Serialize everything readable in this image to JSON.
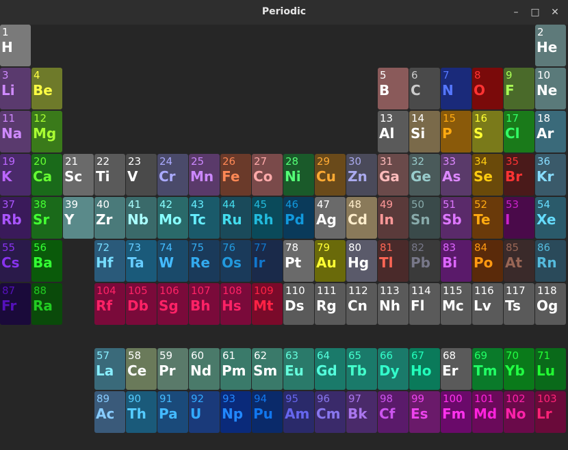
{
  "window": {
    "title": "Periodic",
    "minimize_label": "–",
    "maximize_label": "□",
    "close_label": "✕"
  },
  "elements": [
    {
      "n": "1",
      "s": "H",
      "r": 1,
      "c": 1,
      "bg": "#7a7a7a",
      "fg": "#ffffff"
    },
    {
      "n": "2",
      "s": "He",
      "r": 1,
      "c": 18,
      "bg": "#5e7a7a",
      "fg": "#ffffff"
    },
    {
      "n": "3",
      "s": "Li",
      "r": 2,
      "c": 1,
      "bg": "#5a3a6e",
      "fg": "#cf8aff"
    },
    {
      "n": "4",
      "s": "Be",
      "r": 2,
      "c": 2,
      "bg": "#6e7a2a",
      "fg": "#ffff44"
    },
    {
      "n": "5",
      "s": "B",
      "r": 2,
      "c": 13,
      "bg": "#8a5a5a",
      "fg": "#ffffff"
    },
    {
      "n": "6",
      "s": "C",
      "r": 2,
      "c": 14,
      "bg": "#4a4a4a",
      "fg": "#cccccc"
    },
    {
      "n": "7",
      "s": "N",
      "r": 2,
      "c": 15,
      "bg": "#1a2a7a",
      "fg": "#5577ff"
    },
    {
      "n": "8",
      "s": "O",
      "r": 2,
      "c": 16,
      "bg": "#7a0a0a",
      "fg": "#ff3333"
    },
    {
      "n": "9",
      "s": "F",
      "r": 2,
      "c": 17,
      "bg": "#4a6a2a",
      "fg": "#aaff55"
    },
    {
      "n": "10",
      "s": "Ne",
      "r": 2,
      "c": 18,
      "bg": "#5a7a7a",
      "fg": "#ffffff"
    },
    {
      "n": "11",
      "s": "Na",
      "r": 3,
      "c": 1,
      "bg": "#5a3a6e",
      "fg": "#cf8aff"
    },
    {
      "n": "12",
      "s": "Mg",
      "r": 3,
      "c": 2,
      "bg": "#3a7a1a",
      "fg": "#aaff33"
    },
    {
      "n": "13",
      "s": "Al",
      "r": 3,
      "c": 13,
      "bg": "#5a5a5a",
      "fg": "#ffffff"
    },
    {
      "n": "14",
      "s": "Si",
      "r": 3,
      "c": 14,
      "bg": "#7a6a4a",
      "fg": "#ffffff"
    },
    {
      "n": "15",
      "s": "P",
      "r": 3,
      "c": 15,
      "bg": "#8a5a0a",
      "fg": "#ffaa11"
    },
    {
      "n": "16",
      "s": "S",
      "r": 3,
      "c": 16,
      "bg": "#7a7a1a",
      "fg": "#ffff33"
    },
    {
      "n": "17",
      "s": "Cl",
      "r": 3,
      "c": 17,
      "bg": "#1a7a1a",
      "fg": "#33ff66"
    },
    {
      "n": "18",
      "s": "Ar",
      "r": 3,
      "c": 18,
      "bg": "#3a6a7a",
      "fg": "#ffffff"
    },
    {
      "n": "19",
      "s": "K",
      "r": 4,
      "c": 1,
      "bg": "#4a2a6a",
      "fg": "#bb66ff"
    },
    {
      "n": "20",
      "s": "Ca",
      "r": 4,
      "c": 2,
      "bg": "#1a6a1a",
      "fg": "#66ff33"
    },
    {
      "n": "21",
      "s": "Sc",
      "r": 4,
      "c": 3,
      "bg": "#6a6a6a",
      "fg": "#ffffff"
    },
    {
      "n": "22",
      "s": "Ti",
      "r": 4,
      "c": 4,
      "bg": "#5a5a5a",
      "fg": "#ffffff"
    },
    {
      "n": "23",
      "s": "V",
      "r": 4,
      "c": 5,
      "bg": "#4a4a4a",
      "fg": "#ffffff"
    },
    {
      "n": "24",
      "s": "Cr",
      "r": 4,
      "c": 6,
      "bg": "#4a4a6a",
      "fg": "#aaaaff"
    },
    {
      "n": "25",
      "s": "Mn",
      "r": 4,
      "c": 7,
      "bg": "#5a3a6a",
      "fg": "#cc88ff"
    },
    {
      "n": "26",
      "s": "Fe",
      "r": 4,
      "c": 8,
      "bg": "#6a3a2a",
      "fg": "#ff8855"
    },
    {
      "n": "27",
      "s": "Co",
      "r": 4,
      "c": 9,
      "bg": "#7a4a4a",
      "fg": "#ffaaaa"
    },
    {
      "n": "28",
      "s": "Ni",
      "r": 4,
      "c": 10,
      "bg": "#1a5a2a",
      "fg": "#55ff77"
    },
    {
      "n": "29",
      "s": "Cu",
      "r": 4,
      "c": 11,
      "bg": "#6a4a1a",
      "fg": "#ffaa33"
    },
    {
      "n": "30",
      "s": "Zn",
      "r": 4,
      "c": 12,
      "bg": "#4a4a5a",
      "fg": "#aaaaee"
    },
    {
      "n": "31",
      "s": "Ga",
      "r": 4,
      "c": 13,
      "bg": "#6a4a4a",
      "fg": "#ffbbbb"
    },
    {
      "n": "32",
      "s": "Ge",
      "r": 4,
      "c": 14,
      "bg": "#4a5a5a",
      "fg": "#99cccc"
    },
    {
      "n": "33",
      "s": "As",
      "r": 4,
      "c": 15,
      "bg": "#5a3a6a",
      "fg": "#dd88ff"
    },
    {
      "n": "34",
      "s": "Se",
      "r": 4,
      "c": 16,
      "bg": "#6a4a0a",
      "fg": "#ffcc11"
    },
    {
      "n": "35",
      "s": "Br",
      "r": 4,
      "c": 17,
      "bg": "#4a1a1a",
      "fg": "#ff3333"
    },
    {
      "n": "36",
      "s": "Kr",
      "r": 4,
      "c": 18,
      "bg": "#3a5a6a",
      "fg": "#88ddff"
    },
    {
      "n": "37",
      "s": "Rb",
      "r": 5,
      "c": 1,
      "bg": "#3a1a5a",
      "fg": "#aa55ff"
    },
    {
      "n": "38",
      "s": "Sr",
      "r": 5,
      "c": 2,
      "bg": "#1a6a1a",
      "fg": "#44ff33"
    },
    {
      "n": "39",
      "s": "Y",
      "r": 5,
      "c": 3,
      "bg": "#5a8a8a",
      "fg": "#ffffff"
    },
    {
      "n": "40",
      "s": "Zr",
      "r": 5,
      "c": 4,
      "bg": "#4a7a7a",
      "fg": "#ffffff"
    },
    {
      "n": "41",
      "s": "Nb",
      "r": 5,
      "c": 5,
      "bg": "#3a6a6a",
      "fg": "#aaffff"
    },
    {
      "n": "42",
      "s": "Mo",
      "r": 5,
      "c": 6,
      "bg": "#2a6a6a",
      "fg": "#88ffff"
    },
    {
      "n": "43",
      "s": "Tc",
      "r": 5,
      "c": 7,
      "bg": "#1a5a6a",
      "fg": "#66eeff"
    },
    {
      "n": "44",
      "s": "Ru",
      "r": 5,
      "c": 8,
      "bg": "#1a4a5a",
      "fg": "#44ddee"
    },
    {
      "n": "45",
      "s": "Rh",
      "r": 5,
      "c": 9,
      "bg": "#0a4a5a",
      "fg": "#22bbdd"
    },
    {
      "n": "46",
      "s": "Pd",
      "r": 5,
      "c": 10,
      "bg": "#0a3a5a",
      "fg": "#1199dd"
    },
    {
      "n": "47",
      "s": "Ag",
      "r": 5,
      "c": 11,
      "bg": "#6a6a6a",
      "fg": "#ffffff"
    },
    {
      "n": "48",
      "s": "Cd",
      "r": 5,
      "c": 12,
      "bg": "#8a7a5a",
      "fg": "#ffeecc"
    },
    {
      "n": "49",
      "s": "In",
      "r": 5,
      "c": 13,
      "bg": "#5a3a3a",
      "fg": "#ff9999"
    },
    {
      "n": "50",
      "s": "Sn",
      "r": 5,
      "c": 14,
      "bg": "#3a4a4a",
      "fg": "#88aaaa"
    },
    {
      "n": "51",
      "s": "Sb",
      "r": 5,
      "c": 15,
      "bg": "#5a2a6a",
      "fg": "#dd77ff"
    },
    {
      "n": "52",
      "s": "Te",
      "r": 5,
      "c": 16,
      "bg": "#6a3a0a",
      "fg": "#ffaa11"
    },
    {
      "n": "53",
      "s": "I",
      "r": 5,
      "c": 17,
      "bg": "#4a0a4a",
      "fg": "#cc22cc"
    },
    {
      "n": "54",
      "s": "Xe",
      "r": 5,
      "c": 18,
      "bg": "#2a5a6a",
      "fg": "#66ddff"
    },
    {
      "n": "55",
      "s": "Cs",
      "r": 6,
      "c": 1,
      "bg": "#2a1a4a",
      "fg": "#8833ee"
    },
    {
      "n": "56",
      "s": "Ba",
      "r": 6,
      "c": 2,
      "bg": "#0a5a0a",
      "fg": "#33ff33"
    },
    {
      "n": "72",
      "s": "Hf",
      "r": 6,
      "c": 4,
      "bg": "#2a5a7a",
      "fg": "#77ddff"
    },
    {
      "n": "73",
      "s": "Ta",
      "r": 6,
      "c": 5,
      "bg": "#1a5a7a",
      "fg": "#66ccff"
    },
    {
      "n": "74",
      "s": "W",
      "r": 6,
      "c": 6,
      "bg": "#1a4a6a",
      "fg": "#44bbff"
    },
    {
      "n": "75",
      "s": "Re",
      "r": 6,
      "c": 7,
      "bg": "#1a3a5a",
      "fg": "#33aaee"
    },
    {
      "n": "76",
      "s": "Os",
      "r": 6,
      "c": 8,
      "bg": "#1a3a5a",
      "fg": "#2299dd"
    },
    {
      "n": "77",
      "s": "Ir",
      "r": 6,
      "c": 9,
      "bg": "#1a2a4a",
      "fg": "#1177cc"
    },
    {
      "n": "78",
      "s": "Pt",
      "r": 6,
      "c": 10,
      "bg": "#6a6a6a",
      "fg": "#ffffff"
    },
    {
      "n": "79",
      "s": "Au",
      "r": 6,
      "c": 11,
      "bg": "#6a6a0a",
      "fg": "#ffff33"
    },
    {
      "n": "80",
      "s": "Hg",
      "r": 6,
      "c": 12,
      "bg": "#5a5a6a",
      "fg": "#ffffff"
    },
    {
      "n": "81",
      "s": "Tl",
      "r": 6,
      "c": 13,
      "bg": "#4a2a2a",
      "fg": "#ff6655"
    },
    {
      "n": "82",
      "s": "Pb",
      "r": 6,
      "c": 14,
      "bg": "#3a3a3a",
      "fg": "#777788"
    },
    {
      "n": "83",
      "s": "Bi",
      "r": 6,
      "c": 15,
      "bg": "#5a1a6a",
      "fg": "#dd66ff"
    },
    {
      "n": "84",
      "s": "Po",
      "r": 6,
      "c": 16,
      "bg": "#5a2a0a",
      "fg": "#ff9911"
    },
    {
      "n": "85",
      "s": "At",
      "r": 6,
      "c": 17,
      "bg": "#3a2a2a",
      "fg": "#996655"
    },
    {
      "n": "86",
      "s": "Rn",
      "r": 6,
      "c": 18,
      "bg": "#2a4a5a",
      "fg": "#55bbdd"
    },
    {
      "n": "87",
      "s": "Fr",
      "r": 7,
      "c": 1,
      "bg": "#1a0a3a",
      "fg": "#5511bb"
    },
    {
      "n": "88",
      "s": "Ra",
      "r": 7,
      "c": 2,
      "bg": "#0a4a0a",
      "fg": "#22cc22"
    },
    {
      "n": "104",
      "s": "Rf",
      "r": 7,
      "c": 4,
      "bg": "#7a0a3a",
      "fg": "#ff2266"
    },
    {
      "n": "105",
      "s": "Db",
      "r": 7,
      "c": 5,
      "bg": "#7a0a3a",
      "fg": "#ff2266"
    },
    {
      "n": "106",
      "s": "Sg",
      "r": 7,
      "c": 6,
      "bg": "#7a0a3a",
      "fg": "#ff2266"
    },
    {
      "n": "107",
      "s": "Bh",
      "r": 7,
      "c": 7,
      "bg": "#7a0a3a",
      "fg": "#ff2266"
    },
    {
      "n": "108",
      "s": "Hs",
      "r": 7,
      "c": 8,
      "bg": "#7a0a3a",
      "fg": "#ff2266"
    },
    {
      "n": "109",
      "s": "Mt",
      "r": 7,
      "c": 9,
      "bg": "#7a0a2a",
      "fg": "#ff2244"
    },
    {
      "n": "110",
      "s": "Ds",
      "r": 7,
      "c": 10,
      "bg": "#5a5a5a",
      "fg": "#ffffff"
    },
    {
      "n": "111",
      "s": "Rg",
      "r": 7,
      "c": 11,
      "bg": "#5a5a5a",
      "fg": "#ffffff"
    },
    {
      "n": "112",
      "s": "Cn",
      "r": 7,
      "c": 12,
      "bg": "#5a5a5a",
      "fg": "#ffffff"
    },
    {
      "n": "113",
      "s": "Nh",
      "r": 7,
      "c": 13,
      "bg": "#5a5a5a",
      "fg": "#ffffff"
    },
    {
      "n": "114",
      "s": "Fl",
      "r": 7,
      "c": 14,
      "bg": "#5a5a5a",
      "fg": "#ffffff"
    },
    {
      "n": "115",
      "s": "Mc",
      "r": 7,
      "c": 15,
      "bg": "#5a5a5a",
      "fg": "#ffffff"
    },
    {
      "n": "116",
      "s": "Lv",
      "r": 7,
      "c": 16,
      "bg": "#5a5a5a",
      "fg": "#ffffff"
    },
    {
      "n": "117",
      "s": "Ts",
      "r": 7,
      "c": 17,
      "bg": "#5a5a5a",
      "fg": "#ffffff"
    },
    {
      "n": "118",
      "s": "Og",
      "r": 7,
      "c": 18,
      "bg": "#5a5a5a",
      "fg": "#ffffff"
    },
    {
      "n": "57",
      "s": "La",
      "r": 8.5,
      "c": 4,
      "bg": "#3a6a7a",
      "fg": "#88eeff"
    },
    {
      "n": "58",
      "s": "Ce",
      "r": 8.5,
      "c": 5,
      "bg": "#6a7a5a",
      "fg": "#ffffff"
    },
    {
      "n": "59",
      "s": "Pr",
      "r": 8.5,
      "c": 6,
      "bg": "#5a7a6a",
      "fg": "#ffffff"
    },
    {
      "n": "60",
      "s": "Nd",
      "r": 8.5,
      "c": 7,
      "bg": "#4a7a6a",
      "fg": "#ffffff"
    },
    {
      "n": "61",
      "s": "Pm",
      "r": 8.5,
      "c": 8,
      "bg": "#3a7a6a",
      "fg": "#ffffff"
    },
    {
      "n": "62",
      "s": "Sm",
      "r": 8.5,
      "c": 9,
      "bg": "#3a7a6a",
      "fg": "#ffffff"
    },
    {
      "n": "63",
      "s": "Eu",
      "r": 8.5,
      "c": 10,
      "bg": "#2a7a6a",
      "fg": "#66ffdd"
    },
    {
      "n": "64",
      "s": "Gd",
      "r": 8.5,
      "c": 11,
      "bg": "#1a7a6a",
      "fg": "#55ffdd"
    },
    {
      "n": "65",
      "s": "Tb",
      "r": 8.5,
      "c": 12,
      "bg": "#1a7a6a",
      "fg": "#44ffcc"
    },
    {
      "n": "66",
      "s": "Dy",
      "r": 8.5,
      "c": 13,
      "bg": "#1a7a6a",
      "fg": "#33ffcc"
    },
    {
      "n": "67",
      "s": "Ho",
      "r": 8.5,
      "c": 14,
      "bg": "#0a7a5a",
      "fg": "#22ffbb"
    },
    {
      "n": "68",
      "s": "Er",
      "r": 8.5,
      "c": 15,
      "bg": "#5a5a5a",
      "fg": "#ffffff"
    },
    {
      "n": "69",
      "s": "Tm",
      "r": 8.5,
      "c": 16,
      "bg": "#0a7a2a",
      "fg": "#22ff66"
    },
    {
      "n": "70",
      "s": "Yb",
      "r": 8.5,
      "c": 17,
      "bg": "#0a7a1a",
      "fg": "#22ff44"
    },
    {
      "n": "71",
      "s": "Lu",
      "r": 8.5,
      "c": 18,
      "bg": "#0a6a1a",
      "fg": "#22ff33"
    },
    {
      "n": "89",
      "s": "Ac",
      "r": 9.5,
      "c": 4,
      "bg": "#3a5a7a",
      "fg": "#88ccff"
    },
    {
      "n": "90",
      "s": "Th",
      "r": 9.5,
      "c": 5,
      "bg": "#1a5a7a",
      "fg": "#55ccff"
    },
    {
      "n": "91",
      "s": "Pa",
      "r": 9.5,
      "c": 6,
      "bg": "#1a4a7a",
      "fg": "#44bbff"
    },
    {
      "n": "92",
      "s": "U",
      "r": 9.5,
      "c": 7,
      "bg": "#1a3a7a",
      "fg": "#33aaff"
    },
    {
      "n": "93",
      "s": "Np",
      "r": 9.5,
      "c": 8,
      "bg": "#0a2a7a",
      "fg": "#2288ff"
    },
    {
      "n": "94",
      "s": "Pu",
      "r": 9.5,
      "c": 9,
      "bg": "#0a2a6a",
      "fg": "#1177ee"
    },
    {
      "n": "95",
      "s": "Am",
      "r": 9.5,
      "c": 10,
      "bg": "#2a2a6a",
      "fg": "#6666ee"
    },
    {
      "n": "96",
      "s": "Cm",
      "r": 9.5,
      "c": 11,
      "bg": "#3a2a6a",
      "fg": "#8877ee"
    },
    {
      "n": "97",
      "s": "Bk",
      "r": 9.5,
      "c": 12,
      "bg": "#4a2a6a",
      "fg": "#aa77ee"
    },
    {
      "n": "98",
      "s": "Cf",
      "r": 9.5,
      "c": 13,
      "bg": "#5a1a6a",
      "fg": "#cc55ee"
    },
    {
      "n": "99",
      "s": "Es",
      "r": 9.5,
      "c": 14,
      "bg": "#6a1a6a",
      "fg": "#ee44ee"
    },
    {
      "n": "100",
      "s": "Fm",
      "r": 9.5,
      "c": 15,
      "bg": "#6a0a6a",
      "fg": "#ff33ee"
    },
    {
      "n": "101",
      "s": "Md",
      "r": 9.5,
      "c": 16,
      "bg": "#6a0a5a",
      "fg": "#ff22dd"
    },
    {
      "n": "102",
      "s": "No",
      "r": 9.5,
      "c": 17,
      "bg": "#6a0a4a",
      "fg": "#ff22aa"
    },
    {
      "n": "103",
      "s": "Lr",
      "r": 9.5,
      "c": 18,
      "bg": "#6a0a3a",
      "fg": "#ff2277"
    }
  ]
}
